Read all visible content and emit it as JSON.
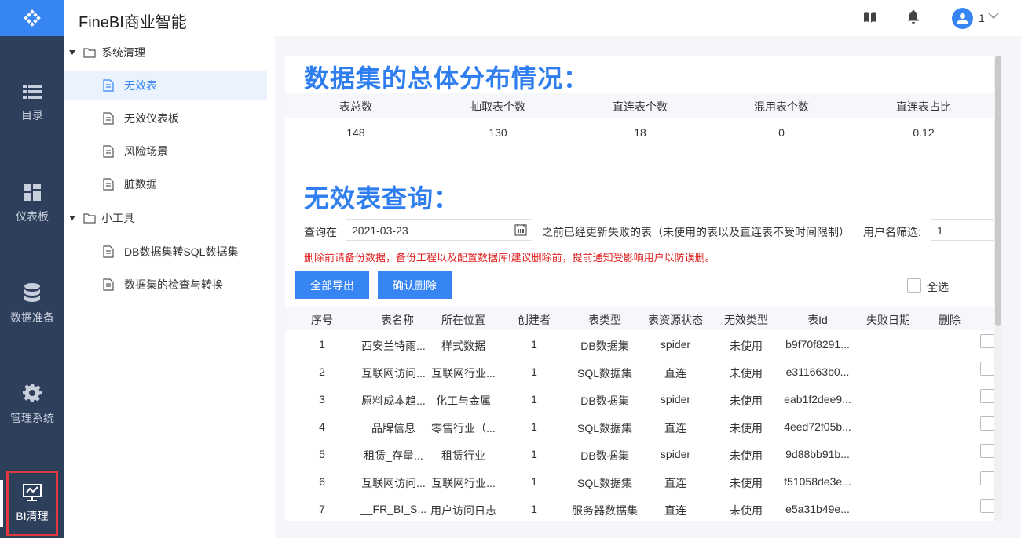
{
  "app": {
    "title": "FineBI商业智能"
  },
  "header": {
    "user_name": "1"
  },
  "leftnav": {
    "items": [
      {
        "label": "目录",
        "icon": "list-icon"
      },
      {
        "label": "仪表板",
        "icon": "dashboard-icon"
      },
      {
        "label": "数据准备",
        "icon": "database-icon"
      },
      {
        "label": "管理系统",
        "icon": "gear-icon"
      },
      {
        "label": "BI清理",
        "icon": "monitor-chart-icon"
      }
    ]
  },
  "tree": {
    "folder1": "系统清理",
    "folder1_items": [
      "无效表",
      "无效仪表板",
      "风险场景",
      "脏数据"
    ],
    "folder2": "小工具",
    "folder2_items": [
      "DB数据集转SQL数据集",
      "数据集的检查与转换"
    ]
  },
  "overview": {
    "title": "数据集的总体分布情况：",
    "headers": [
      "表总数",
      "抽取表个数",
      "直连表个数",
      "混用表个数",
      "直连表占比"
    ],
    "values": [
      "148",
      "130",
      "18",
      "0",
      "0.12"
    ]
  },
  "query": {
    "title": "无效表查询：",
    "label_before": "查询在",
    "date_value": "2021-03-23",
    "label_after": "之前已经更新失败的表（未使用的表以及直连表不受时间限制）",
    "user_filter_label": "用户名筛选:",
    "user_filter_value": "1",
    "warning": "删除前请备份数据，备份工程以及配置数据库!建议删除前，提前通知受影响用户以防误删。",
    "export_label": "全部导出",
    "delete_label": "确认删除",
    "select_all_label": "全选"
  },
  "table": {
    "columns": [
      "序号",
      "表名称",
      "所在位置",
      "创建者",
      "表类型",
      "表资源状态",
      "无效类型",
      "表Id",
      "失败日期",
      "删除"
    ],
    "rows": [
      [
        "1",
        "西安兰特雨...",
        "样式数据",
        "1",
        "DB数据集",
        "spider",
        "未使用",
        "b9f70f8291...",
        ""
      ],
      [
        "2",
        "互联网访问...",
        "互联网行业...",
        "1",
        "SQL数据集",
        "直连",
        "未使用",
        "e311663b0...",
        ""
      ],
      [
        "3",
        "原料成本趋...",
        "化工与金属",
        "1",
        "DB数据集",
        "spider",
        "未使用",
        "eab1f2dee9...",
        ""
      ],
      [
        "4",
        "品牌信息",
        "零售行业（...",
        "1",
        "SQL数据集",
        "直连",
        "未使用",
        "4eed72f05b...",
        ""
      ],
      [
        "5",
        "租赁_存量...",
        "租赁行业",
        "1",
        "DB数据集",
        "spider",
        "未使用",
        "9d88bb91b...",
        ""
      ],
      [
        "6",
        "互联网访问...",
        "互联网行业...",
        "1",
        "SQL数据集",
        "直连",
        "未使用",
        "f51058de3e...",
        ""
      ],
      [
        "7",
        "__FR_BI_S...",
        "用户访问日志",
        "1",
        "服务器数据集",
        "直连",
        "未使用",
        "e5a31b49e...",
        ""
      ]
    ]
  },
  "colors": {
    "accent": "#3685f2",
    "nav_bg": "#2e3f5c",
    "title_blue": "#2f7ef0",
    "warning_red": "#e02020"
  }
}
